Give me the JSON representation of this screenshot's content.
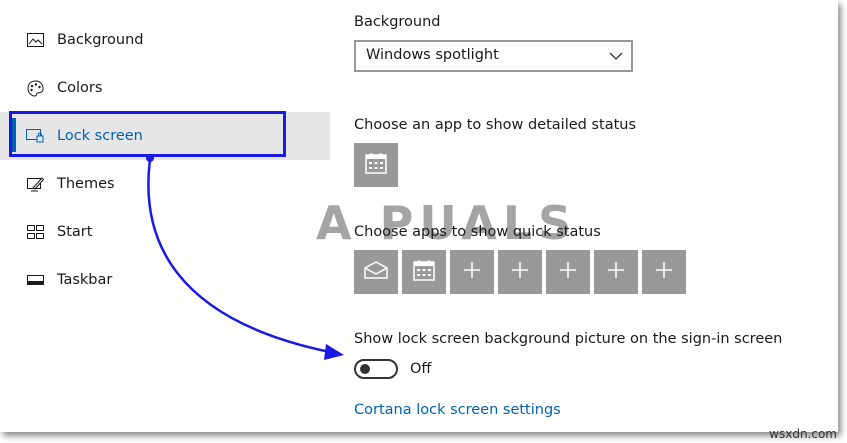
{
  "sidebar": {
    "items": [
      {
        "label": "Background",
        "icon": "picture-icon"
      },
      {
        "label": "Colors",
        "icon": "palette-icon"
      },
      {
        "label": "Lock screen",
        "icon": "lock-screen-icon",
        "selected": true
      },
      {
        "label": "Themes",
        "icon": "themes-icon"
      },
      {
        "label": "Start",
        "icon": "start-icon"
      },
      {
        "label": "Taskbar",
        "icon": "taskbar-icon"
      }
    ]
  },
  "main": {
    "background_label": "Background",
    "background_value": "Windows spotlight",
    "detailed_status_label": "Choose an app to show detailed status",
    "quick_status_label": "Choose apps to show quick status",
    "signin_label": "Show lock screen background picture on the sign-in screen",
    "toggle_state": "Off",
    "cortana_link": "Cortana lock screen settings"
  },
  "quick_status_tiles": [
    "mail-icon",
    "calendar-icon",
    "plus-icon",
    "plus-icon",
    "plus-icon",
    "plus-icon",
    "plus-icon"
  ],
  "watermark": {
    "logo_text": "A PUALS",
    "site_text": "wsxdn.com"
  },
  "colors": {
    "accent": "#0063b1",
    "annotation": "#1a1ae6",
    "tile": "#999999",
    "selected_bg": "#e6e6e6"
  }
}
